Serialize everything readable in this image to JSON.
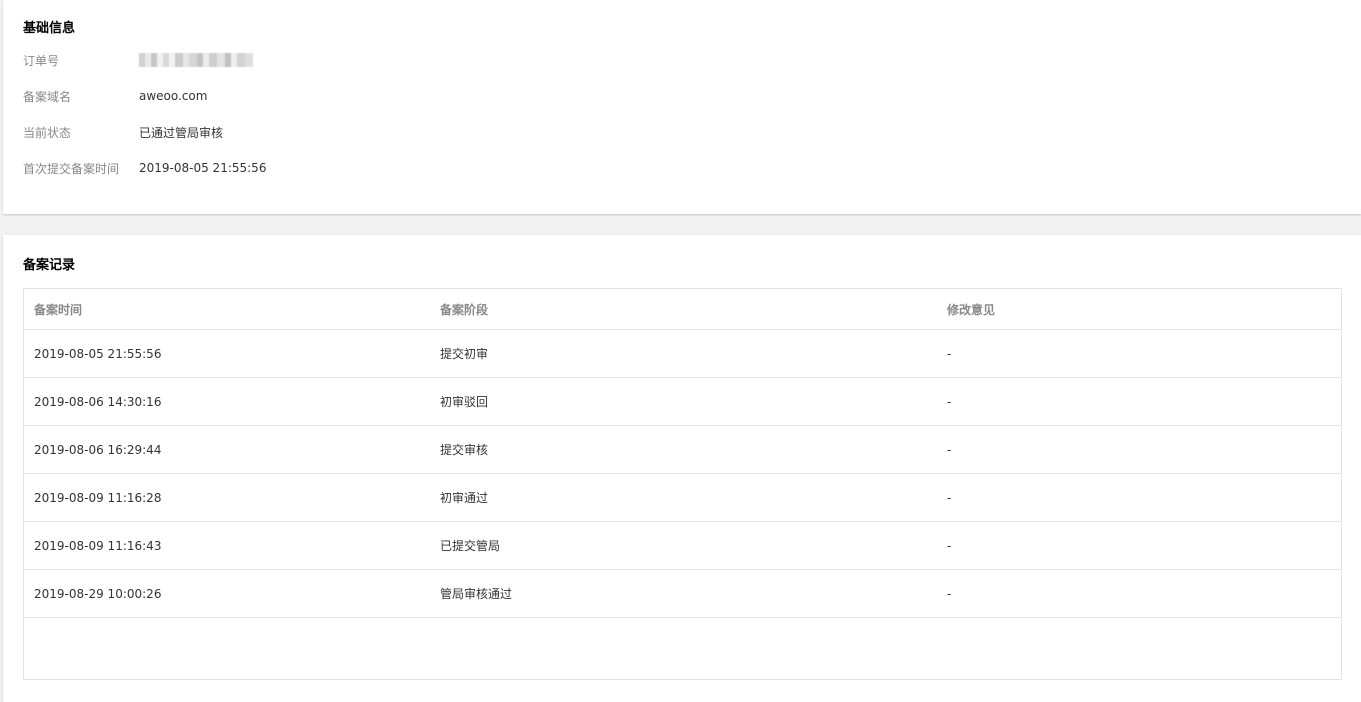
{
  "basic": {
    "title": "基础信息",
    "fields": [
      {
        "label": "订单号",
        "value": ""
      },
      {
        "label": "备案域名",
        "value": "aweoo.com"
      },
      {
        "label": "当前状态",
        "value": "已通过管局审核"
      },
      {
        "label": "首次提交备案时间",
        "value": "2019-08-05 21:55:56"
      }
    ]
  },
  "records": {
    "title": "备案记录",
    "columns": [
      "备案时间",
      "备案阶段",
      "修改意见"
    ],
    "rows": [
      {
        "time": "2019-08-05 21:55:56",
        "stage": "提交初审",
        "comment": "-"
      },
      {
        "time": "2019-08-06 14:30:16",
        "stage": "初审驳回",
        "comment": "-"
      },
      {
        "time": "2019-08-06 16:29:44",
        "stage": "提交审核",
        "comment": "-"
      },
      {
        "time": "2019-08-09 11:16:28",
        "stage": "初审通过",
        "comment": "-"
      },
      {
        "time": "2019-08-09 11:16:43",
        "stage": "已提交管局",
        "comment": "-"
      },
      {
        "time": "2019-08-29 10:00:26",
        "stage": "管局审核通过",
        "comment": "-"
      }
    ]
  }
}
